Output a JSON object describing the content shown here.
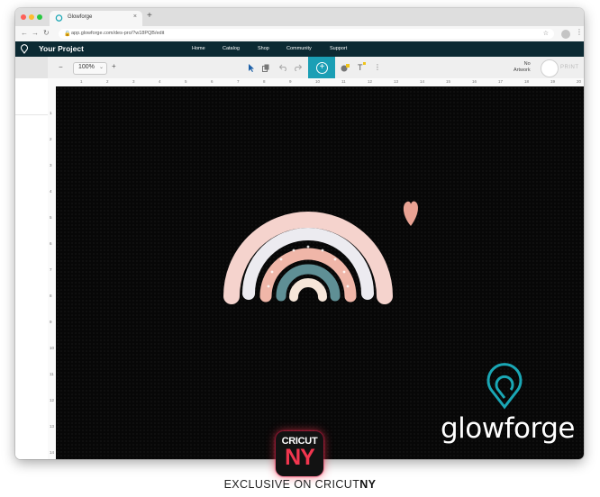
{
  "browser": {
    "tab_title": "Glowforge",
    "tab_close": "×",
    "new_tab": "+",
    "url": "app.glowforge.com/des-pro/?w18PQB/edit",
    "back": "←",
    "forward": "→",
    "reload": "↻",
    "lock": "🔒",
    "bookmark": "☆",
    "menu": "⋮"
  },
  "app": {
    "title": "Your Project",
    "nav": [
      "Home",
      "Catalog",
      "Shop",
      "Community",
      "Support"
    ]
  },
  "toolbar": {
    "zoom_out": "−",
    "zoom_value": "100%",
    "zoom_caret": "⌄",
    "zoom_in": "+",
    "add_icon": "+",
    "text_tool": "T",
    "more": "⋮",
    "no_artwork_line1": "No",
    "no_artwork_line2": "Artwork",
    "print_label": "PRINT"
  },
  "rulers": {
    "horizontal": [
      "1",
      "2",
      "3",
      "4",
      "5",
      "6",
      "7",
      "8",
      "9",
      "10",
      "11",
      "12",
      "13",
      "14",
      "15",
      "16",
      "17",
      "18",
      "19",
      "20"
    ],
    "vertical": [
      "1",
      "2",
      "3",
      "4",
      "5",
      "6",
      "7",
      "8",
      "9",
      "10",
      "11",
      "12",
      "13",
      "14"
    ]
  },
  "artwork": {
    "brand_name": "glowforge",
    "colors": {
      "outer_arc": "#f5d3cd",
      "second_arc": "#ecebf0",
      "third_arc": "#f0b6a8",
      "fourth_arc": "#5f8f95",
      "inner_arc": "#f6e6d9",
      "heart": "#e9a293",
      "logo": "#1aa7b5"
    }
  },
  "footer": {
    "badge_top": "CRICUT",
    "badge_bottom": "NY",
    "caption_prefix": "EXCLUSIVE ON CRICUT",
    "caption_bold": "NY",
    "accent": "#f2364f"
  }
}
